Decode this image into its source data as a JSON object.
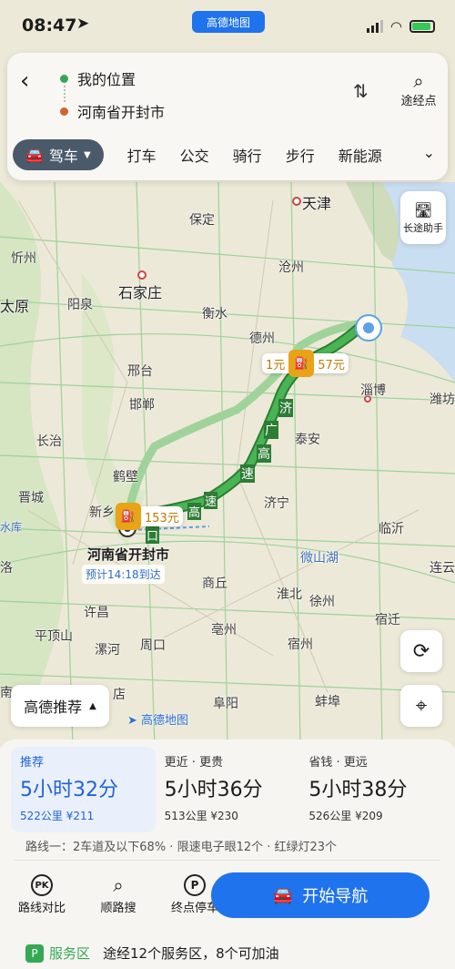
{
  "status_bar": {
    "time": "08:47",
    "brand": "高德地图"
  },
  "search": {
    "origin": "我的位置",
    "destination": "河南省开封市",
    "via_label": "途经点",
    "modes": {
      "active": "驾车",
      "items": [
        "打车",
        "公交",
        "骑行",
        "步行",
        "新能源"
      ]
    }
  },
  "map": {
    "cities": {
      "tianjin": "天津",
      "baoding": "保定",
      "xinzhou": "忻州",
      "cangzhou": "沧州",
      "shijiazhuang": "石家庄",
      "taiyuan": "太原",
      "yangquan": "阳泉",
      "hengshui": "衡水",
      "dezhou": "德州",
      "xingtai": "邢台",
      "handan": "邯郸",
      "zibo": "淄博",
      "weifang": "潍坊",
      "changzhi": "长治",
      "taian": "泰安",
      "hebi": "鹤壁",
      "jincheng": "晋城",
      "jining": "济宁",
      "xinxiang": "新乡",
      "shuiku": "水库",
      "linyi": "临沂",
      "luo": "洛",
      "weishanhu": "微山湖",
      "lianyungang": "连云",
      "shangqiu": "商丘",
      "huaibei": "淮北",
      "xuzhou": "徐州",
      "xuchang": "许昌",
      "suqian": "宿迁",
      "pingdingshan": "平顶山",
      "bozhou": "亳州",
      "luohe": "漯河",
      "zhoukou": "周口",
      "suzhou": "宿州",
      "nan": "南",
      "dian": "店",
      "fuyang": "阜阳",
      "bengbu": "蚌埠"
    },
    "dest_label": "河南省开封市",
    "eta": "预计14:18到达",
    "road_labels": {
      "ji": "济",
      "guang": "广",
      "gao": "高",
      "su": "速",
      "jsu": "速",
      "jgao": "高",
      "kou": "口"
    },
    "long_trip_label": "长途助手",
    "fuel_markers": [
      {
        "left": "1元",
        "right": "57元"
      },
      {
        "left": "",
        "right": "153元"
      }
    ],
    "recommend_label": "高德推荐",
    "logo": "高德地图"
  },
  "routes": [
    {
      "tag": "推荐",
      "duration": "5小时32分",
      "distance": "522公里",
      "toll": "¥211",
      "selected": true
    },
    {
      "tag": "更近 · 更贵",
      "duration": "5小时36分",
      "distance": "513公里",
      "toll": "¥230",
      "selected": false
    },
    {
      "tag": "省钱 · 更远",
      "duration": "5小时38分",
      "distance": "526公里",
      "toll": "¥209",
      "selected": false
    }
  ],
  "route_summary": "路线一：2车道及以下68% · 限速电子眼12个 · 红绿灯23个",
  "actions": {
    "compare": "路线对比",
    "along_search": "顺路搜",
    "parking": "终点停车",
    "start_nav": "开始导航"
  },
  "service": {
    "label": "服务区",
    "text": "途经12个服务区，8个可加油"
  },
  "colors": {
    "primary": "#1f73ec",
    "route_green": "#3fae4a",
    "fuel": "#e8a317"
  }
}
